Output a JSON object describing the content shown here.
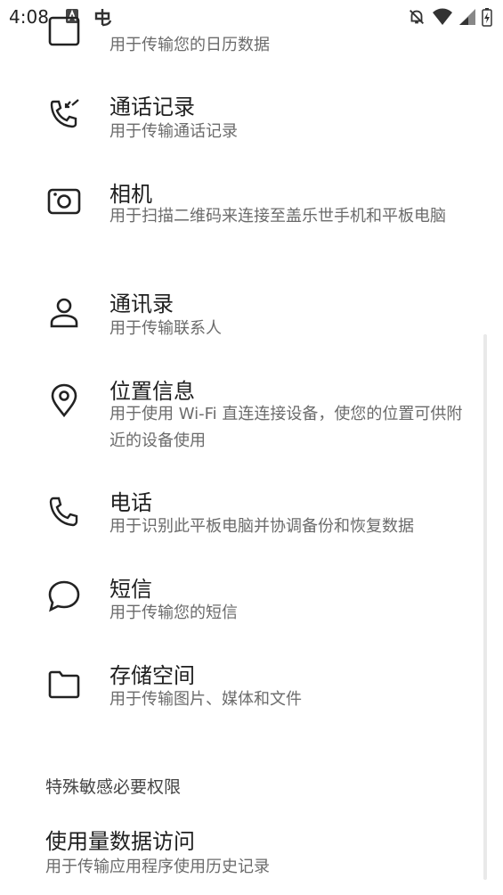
{
  "status_bar": {
    "time": "4:08"
  },
  "permissions": [
    {
      "icon": "calendar-icon",
      "title": "",
      "subtitle": "用于传输您的日历数据"
    },
    {
      "icon": "call-log-icon",
      "title": "通话记录",
      "subtitle": "用于传输通话记录"
    },
    {
      "icon": "camera-icon",
      "title": "相机",
      "subtitle": "用于扫描二维码来连接至盖乐世手机和平板电脑"
    },
    {
      "icon": "contacts-icon",
      "title": "通讯录",
      "subtitle": "用于传输联系人"
    },
    {
      "icon": "location-icon",
      "title": "位置信息",
      "subtitle": "用于使用 Wi-Fi 直连连接设备，使您的位置可供附近的设备使用"
    },
    {
      "icon": "phone-icon",
      "title": "电话",
      "subtitle": "用于识别此平板电脑并协调备份和恢复数据"
    },
    {
      "icon": "sms-icon",
      "title": "短信",
      "subtitle": "用于传输您的短信"
    },
    {
      "icon": "folder-icon",
      "title": "存储空间",
      "subtitle": "用于传输图片、媒体和文件"
    }
  ],
  "special_section": {
    "header": "特殊敏感必要权限",
    "item_title": "使用量数据访问",
    "item_subtitle": "用于传输应用程序使用历史记录"
  }
}
